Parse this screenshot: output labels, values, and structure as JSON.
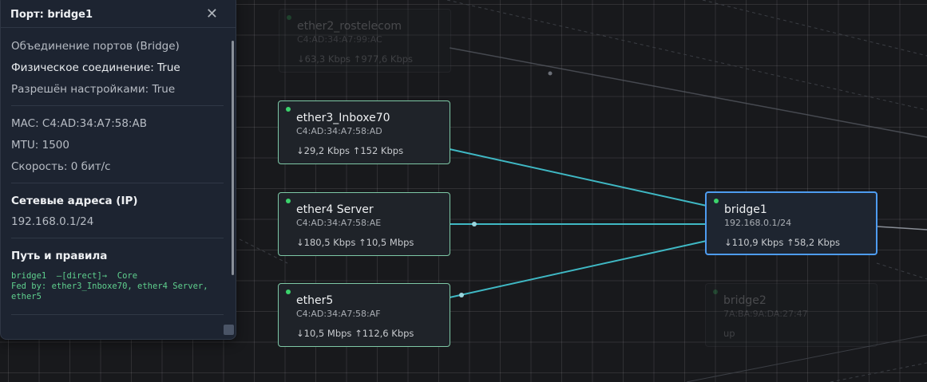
{
  "panel": {
    "title": "Порт: bridge1",
    "close_glyph": "✕",
    "type_line": "Объединение портов (Bridge)",
    "physical": "Физическое соединение: True",
    "enabled": "Разрешён настройками: True",
    "mac": "MAC: C4:AD:34:A7:58:AB",
    "mtu": "MTU: 1500",
    "speed": "Скорость: 0 бит/с",
    "ip_section_title": "Сетевые адреса (IP)",
    "ip": "192.168.0.1/24",
    "path_section_title": "Путь и правила",
    "path_text": "bridge1  —[direct]→  Core\nFed by: ether3_Inboxe70, ether4 Server,\nether5"
  },
  "nodes": {
    "ether2": {
      "name": "ether2_rostelecom",
      "mac": "C4:AD:34:A7:99:AC",
      "rate": "↓63,3 Kbps ↑977,6 Kbps"
    },
    "ether3": {
      "name": "ether3_Inboxe70",
      "mac": "C4:AD:34:A7:58:AD",
      "rate": "↓29,2 Kbps ↑152 Kbps"
    },
    "ether4": {
      "name": "ether4 Server",
      "mac": "C4:AD:34:A7:58:AE",
      "rate": "↓180,5 Kbps ↑10,5 Mbps"
    },
    "ether5": {
      "name": "ether5",
      "mac": "C4:AD:34:A7:58:AF",
      "rate": "↓10,5 Mbps ↑112,6 Kbps"
    },
    "bridge1": {
      "name": "bridge1",
      "mac": "192.168.0.1/24",
      "rate": "↓110,9 Kbps ↑58,2 Kbps"
    },
    "bridge2": {
      "name": "bridge2",
      "mac": "7A:BA:9A:DA:27:47",
      "rate": "up"
    }
  },
  "colors": {
    "link": "#3fb8c4",
    "node_border": "#7ec8a6",
    "selected_border": "#4e9cf0",
    "status_up": "#3bd36c"
  }
}
